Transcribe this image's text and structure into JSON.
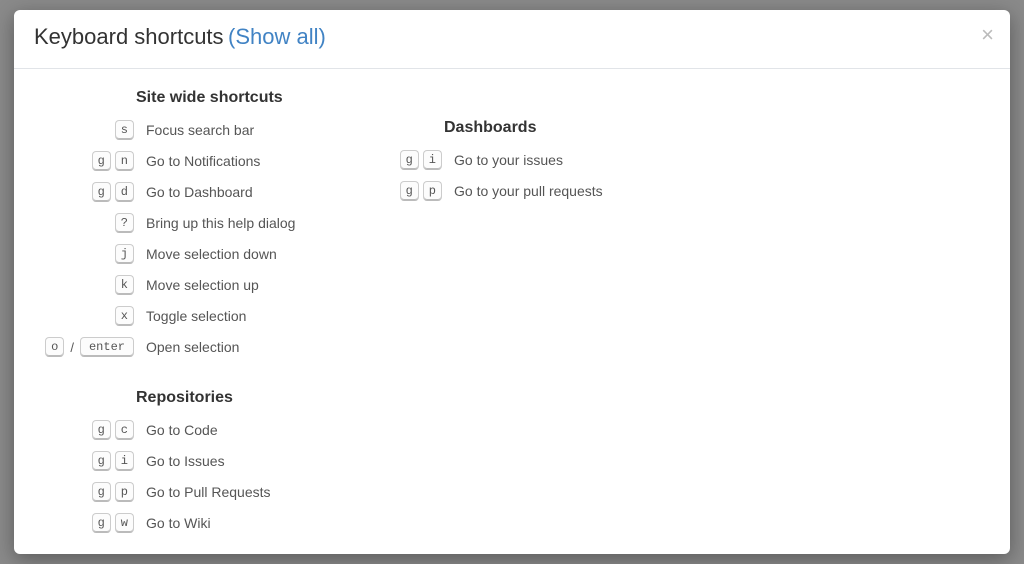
{
  "header": {
    "title": "Keyboard shortcuts",
    "show_all": "(Show all)"
  },
  "sections": {
    "sitewide": {
      "title": "Site wide shortcuts",
      "items": [
        {
          "keys": [
            "s"
          ],
          "desc": "Focus search bar"
        },
        {
          "keys": [
            "g",
            "n"
          ],
          "desc": "Go to Notifications"
        },
        {
          "keys": [
            "g",
            "d"
          ],
          "desc": "Go to Dashboard"
        },
        {
          "keys": [
            "?"
          ],
          "desc": "Bring up this help dialog"
        },
        {
          "keys": [
            "j"
          ],
          "desc": "Move selection down"
        },
        {
          "keys": [
            "k"
          ],
          "desc": "Move selection up"
        },
        {
          "keys": [
            "x"
          ],
          "desc": "Toggle selection"
        },
        {
          "combo": {
            "left": "o",
            "sep": "/",
            "right": "enter"
          },
          "desc": "Open selection"
        }
      ]
    },
    "repositories": {
      "title": "Repositories",
      "items": [
        {
          "keys": [
            "g",
            "c"
          ],
          "desc": "Go to Code"
        },
        {
          "keys": [
            "g",
            "i"
          ],
          "desc": "Go to Issues"
        },
        {
          "keys": [
            "g",
            "p"
          ],
          "desc": "Go to Pull Requests"
        },
        {
          "keys": [
            "g",
            "w"
          ],
          "desc": "Go to Wiki"
        }
      ]
    },
    "dashboards": {
      "title": "Dashboards",
      "items": [
        {
          "keys": [
            "g",
            "i"
          ],
          "desc": "Go to your issues"
        },
        {
          "keys": [
            "g",
            "p"
          ],
          "desc": "Go to your pull requests"
        }
      ]
    }
  }
}
